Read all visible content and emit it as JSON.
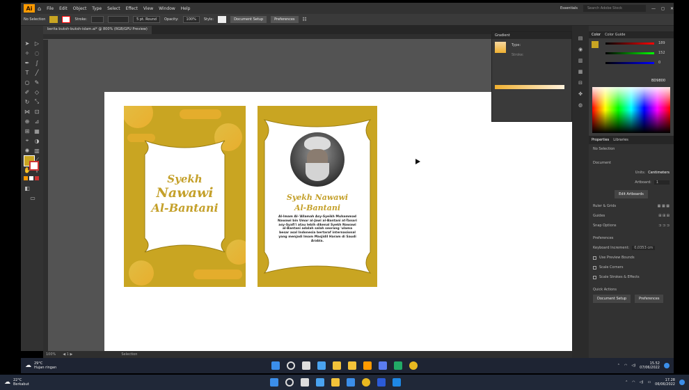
{
  "app": {
    "logo": "Ai",
    "menu": [
      "File",
      "Edit",
      "Object",
      "Type",
      "Select",
      "Effect",
      "View",
      "Window",
      "Help"
    ],
    "workspace": "Essentials",
    "search_placeholder": "Search Adobe Stock"
  },
  "control": {
    "selection": "No Selection",
    "stroke_label": "Stroke:",
    "brush": "5 pt. Round",
    "opacity_label": "Opacity:",
    "opacity": "100%",
    "style_label": "Style:",
    "doc_setup": "Document Setup",
    "preferences": "Preferences"
  },
  "document": {
    "tab": "berita buksh-buksh-islam.ai* @ 800% (RGB/GPU Preview)",
    "zoom": "100%",
    "status": "Selection"
  },
  "cover": {
    "line1": "Syekh",
    "line2": "Nawawi",
    "line3": "Al-Bantani"
  },
  "bio": {
    "name1": "Syekh Nawawi",
    "name2": "Al-Bantani",
    "text": "Al-Imam Al-'Allamah Asy-Syeikh Muhammad Nawawi bin Umar al-Jawi al-Bantani at-Tanari asy-Syafi'i atau lebih dikenal Syekh Nawawi al-Bantani adalah salah seorang 'ulama besar asal Indonesia bertaraf internasional yang menjadi Imam Masjidil Haram di Saudi Arabia."
  },
  "gradient_panel": {
    "title": "Gradient",
    "type_label": "Type:",
    "stroke_label": "Stroke:"
  },
  "color_panel": {
    "tabs": [
      "Color",
      "Color Guide"
    ],
    "values": [
      "189",
      "152",
      "0"
    ],
    "hex": "BD9800"
  },
  "properties": {
    "tabs": [
      "Properties",
      "Libraries"
    ],
    "no_selection": "No Selection",
    "document": "Document",
    "units_label": "Units:",
    "units": "Centimeters",
    "artboard_label": "Artboard:",
    "artboard": "1",
    "edit_artboards": "Edit Artboards",
    "rulers_grids": "Ruler & Grids",
    "guides": "Guides",
    "snap_options": "Snap Options",
    "preferences": "Preferences",
    "keyboard_increment_label": "Keyboard Increment:",
    "keyboard_increment": "0,0353 cm",
    "opt1": "Use Preview Bounds",
    "opt2": "Scale Corners",
    "opt3": "Scale Strokes & Effects",
    "quick_actions": "Quick Actions",
    "doc_setup": "Document Setup",
    "prefs_button": "Preferences"
  },
  "taskbar_inner": {
    "temp": "29°C",
    "weather": "Hujan ringan",
    "time": "15.52",
    "date": "07/06/2022"
  },
  "taskbar_outer": {
    "temp": "22°C",
    "weather": "Berkabut",
    "time": "17.28",
    "date": "06/06/2022"
  },
  "colors": {
    "gold": "#c9a522",
    "accent": "#ff9a00"
  }
}
